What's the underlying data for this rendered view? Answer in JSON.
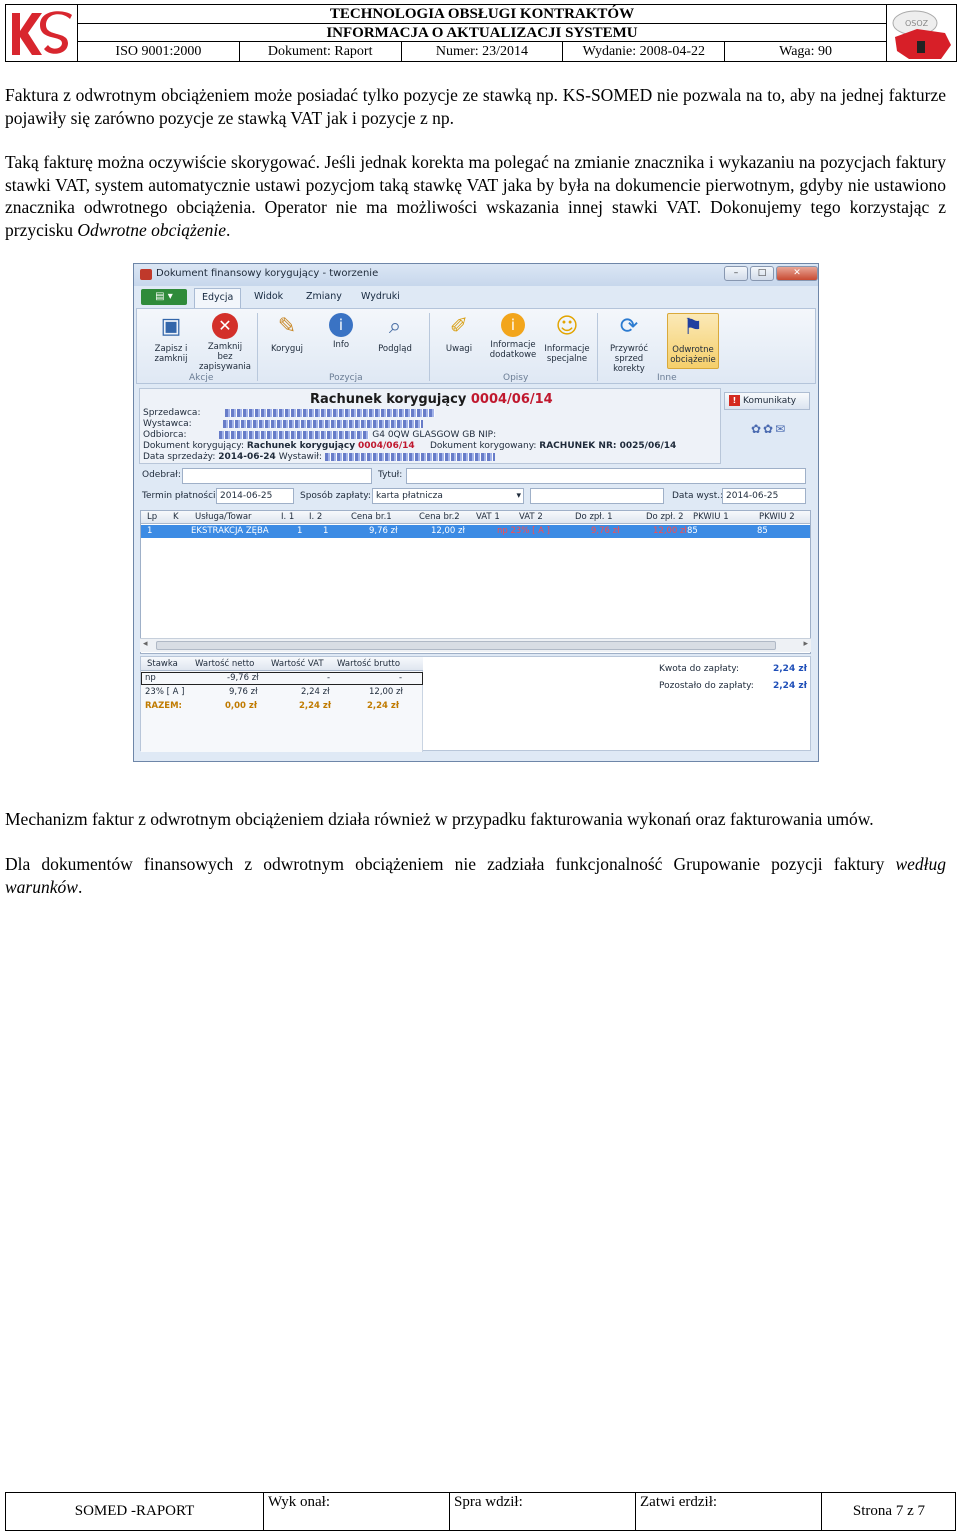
{
  "header": {
    "title1": "TECHNOLOGIA OBSŁUGI KONTRAKTÓW",
    "title2": "INFORMACJA O AKTUALIZACJI SYSTEMU",
    "iso": "ISO 9001:2000",
    "dokument": "Dokument: Raport",
    "numer": "Numer: 23/2014",
    "wydanie": "Wydanie: 2008-04-22",
    "waga": "Waga: 90",
    "logo_left": "KS",
    "logo_right": "OSOZ"
  },
  "body": {
    "p1": "Faktura z odwrotnym obciążeniem może posiadać tylko pozycje ze stawką np. KS-SOMED nie pozwala na to, aby na jednej fakturze pojawiły się zarówno pozycje ze stawką VAT jak i pozycje z np.",
    "p2_text": "Taką fakturę można oczywiście skorygować. Jeśli jednak korekta ma polegać na zmianie znacznika i wykazaniu na pozycjach faktury stawki VAT, system automatycznie ustawi pozycjom taką stawkę VAT jaka by była na dokumencie pierwotnym, gdyby nie ustawiono znacznika odwrotnego obciążenia. Operator nie ma możliwości wskazania innej stawki VAT. Dokonujemy tego korzystając z przycisku ",
    "p2_em": "Odwrotne obciążenie",
    "p2_end": ".",
    "p3": "Mechanizm faktur z odwrotnym obciążeniem działa również w przypadku fakturowania wykonań oraz fakturowania umów.",
    "p4_text": "Dla dokumentów finansowych z odwrotnym obciążeniem nie zadziała funkcjonalność Grupowanie pozycji faktury ",
    "p4_em": "według warunków",
    "p4_end": "."
  },
  "window": {
    "title": "Dokument finansowy korygujący - tworzenie",
    "menu": [
      "Edycja",
      "Widok",
      "Zmiany",
      "Wydruki"
    ],
    "ribbon": {
      "buttons": [
        {
          "label": "Zapisz i zamknij"
        },
        {
          "label": "Zamknij bez zapisywania"
        },
        {
          "label": "Koryguj"
        },
        {
          "label": "Info"
        },
        {
          "label": "Podgląd"
        },
        {
          "label": "Uwagi"
        },
        {
          "label": "Informacje dodatkowe"
        },
        {
          "label": "Informacje specjalne"
        },
        {
          "label": "Przywróć sprzed korekty"
        },
        {
          "label": "Odwrotne obciążenie"
        }
      ],
      "groups": [
        "Akcje",
        "Pozycja",
        "Opisy",
        "Inne"
      ]
    },
    "doc": {
      "title": "Rachunek korygujący",
      "number": "0004/06/14",
      "sprzedawca": "Sprzedawca:",
      "wystawca": "Wystawca:",
      "odbiorca": "Odbiorca:",
      "odbiorca_tail": "G4 0QW GLASGOW GB NIP:",
      "dok_kor_label": "Dokument korygujący:",
      "dok_kor_value": "Rachunek korygujący",
      "dok_kor_num": "0004/06/14",
      "dok_korygowany_label": "Dokument korygowany:",
      "dok_korygowany_value": "RACHUNEK NR: 0025/06/14",
      "data_sprzedazy_label": "Data sprzedaży:",
      "data_sprzedazy": "2014-06-24",
      "wystawil_label": "Wystawił:"
    },
    "komunikaty": "Komunikaty",
    "fields": {
      "odebral": "Odebrał:",
      "tytul": "Tytuł:",
      "termin_label": "Termin płatności:",
      "termin": "2014-06-25",
      "sposob_label": "Sposób zapłaty:",
      "sposob": "karta płatnicza",
      "data_wyst_label": "Data wyst.:",
      "data_wyst": "2014-06-25"
    },
    "grid": {
      "headers": [
        "Lp",
        "K",
        "Usługa/Towar",
        "I. 1",
        "I. 2",
        "Cena br.1",
        "Cena br.2",
        "VAT 1",
        "VAT 2",
        "Do zpł. 1",
        "Do zpł. 2",
        "PKWIU 1",
        "PKWIU 2"
      ],
      "row": [
        "1",
        "",
        "EKSTRAKCJA ZĘBA",
        "1",
        "1",
        "9,76 zł",
        "12,00 zł",
        "np 23% [ A ]",
        "",
        "9,76 zł",
        "12,00 zł",
        "85",
        "85"
      ]
    },
    "vat": {
      "headers": [
        "Stawka",
        "Wartość netto",
        "Wartość VAT",
        "Wartość brutto"
      ],
      "rows": [
        [
          "np",
          "-9,76 zł",
          "-",
          "-"
        ],
        [
          "23% [ A ]",
          "9,76 zł",
          "2,24 zł",
          "12,00 zł"
        ]
      ],
      "sum": [
        "RAZEM:",
        "0,00 zł",
        "2,24 zł",
        "2,24 zł"
      ]
    },
    "totals": {
      "kwota_label": "Kwota do zapłaty:",
      "kwota": "2,24 zł",
      "pozostalo_label": "Pozostało do zapłaty:",
      "pozostalo": "2,24 zł"
    }
  },
  "footer": {
    "c1": "SOMED -RAPORT",
    "c2": "Wyk onał:",
    "c3": "Spra wdził:",
    "c4": "Zatwi erdził:",
    "c5": "Strona 7 z 7"
  },
  "colors": {
    "accent_red": "#c0182e",
    "grid_selection": "#3c8be4",
    "window_bg": "#dfe9f5"
  }
}
